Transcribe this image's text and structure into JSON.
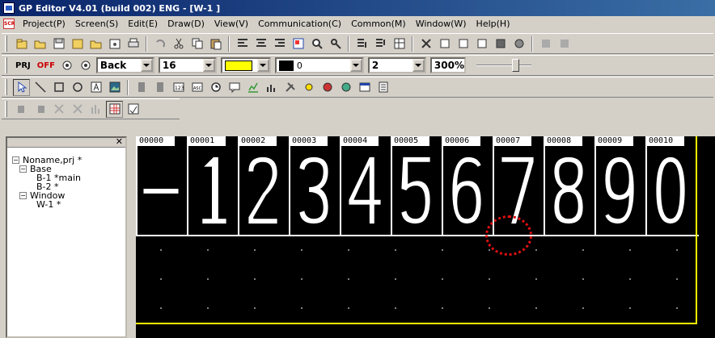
{
  "window": {
    "title": "GP Editor V4.01 (build 002) ENG - [W-1 ]"
  },
  "menu": {
    "items": [
      "Project(P)",
      "Screen(S)",
      "Edit(E)",
      "Draw(D)",
      "View(V)",
      "Communication(C)",
      "Common(M)",
      "Window(W)",
      "Help(H)"
    ]
  },
  "toolbar3": {
    "prj_label": "PRJ",
    "off_label": "OFF",
    "mode_value": "Back",
    "font_size_value": "16",
    "fg_color": "#ffff00",
    "bg_color": "#000000",
    "bg_value": "0",
    "line_width_value": "2",
    "zoom_value": "300%"
  },
  "tree": {
    "project": "Noname,prj *",
    "base": "Base",
    "base_items": [
      "B-1 *main",
      "B-2 *"
    ],
    "window": "Window",
    "window_items": [
      "W-1 *"
    ]
  },
  "panels": [
    {
      "label": "00000",
      "digit": "-"
    },
    {
      "label": "00001",
      "digit": "1"
    },
    {
      "label": "00002",
      "digit": "2"
    },
    {
      "label": "00003",
      "digit": "3"
    },
    {
      "label": "00004",
      "digit": "4"
    },
    {
      "label": "00005",
      "digit": "5"
    },
    {
      "label": "00006",
      "digit": "6"
    },
    {
      "label": "00007",
      "digit": "7"
    },
    {
      "label": "00008",
      "digit": "8"
    },
    {
      "label": "00009",
      "digit": "9"
    },
    {
      "label": "00010",
      "digit": "0"
    }
  ],
  "colors": {
    "canvas_border": "#ffff00",
    "highlight_circle": "#e01010"
  }
}
